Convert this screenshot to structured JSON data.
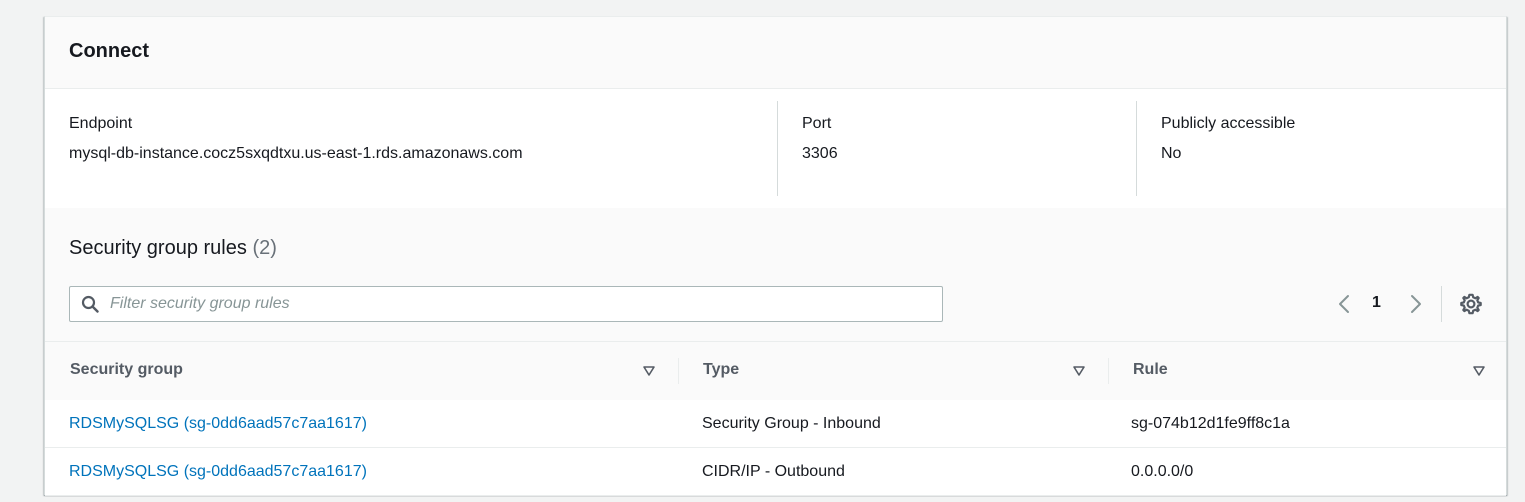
{
  "connect": {
    "title": "Connect",
    "endpoint": {
      "label": "Endpoint",
      "value": "mysql-db-instance.cocz5sxqdtxu.us-east-1.rds.amazonaws.com"
    },
    "port": {
      "label": "Port",
      "value": "3306"
    },
    "public": {
      "label": "Publicly accessible",
      "value": "No"
    }
  },
  "security_rules": {
    "title": "Security group rules",
    "count": "(2)",
    "filter_placeholder": "Filter security group rules",
    "filter_value": "",
    "page": "1",
    "columns": [
      "Security group",
      "Type",
      "Rule"
    ],
    "rows": [
      {
        "group": "RDSMySQLSG (sg-0dd6aad57c7aa1617)",
        "type": "Security Group - Inbound",
        "rule": "sg-074b12d1fe9ff8c1a"
      },
      {
        "group": "RDSMySQLSG (sg-0dd6aad57c7aa1617)",
        "type": "CIDR/IP - Outbound",
        "rule": "0.0.0.0/0"
      }
    ]
  },
  "colors": {
    "link": "#0073bb",
    "text": "#16191f",
    "muted": "#687078",
    "border": "#d5dbdb"
  },
  "icons": {
    "search": "search-icon",
    "prev": "chevron-left-icon",
    "next": "chevron-right-icon",
    "settings": "gear-icon",
    "sort": "caret-down-icon"
  }
}
